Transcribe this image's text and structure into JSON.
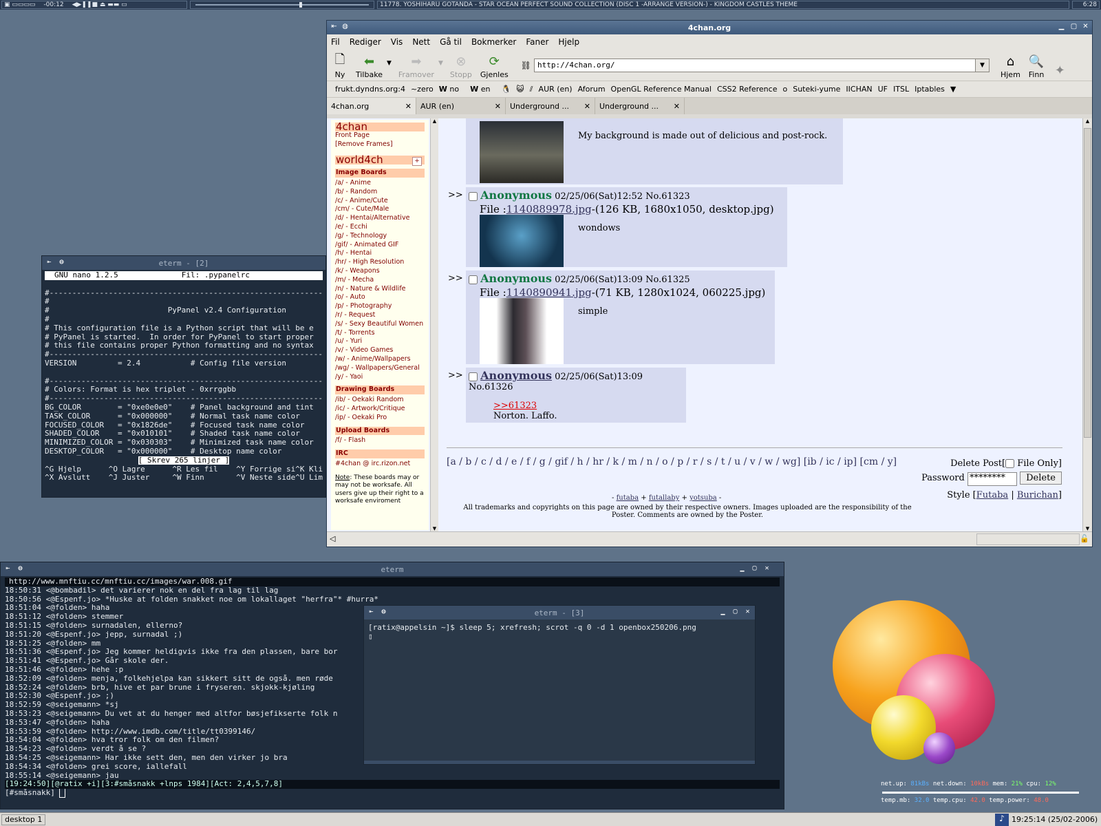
{
  "topbar": {
    "clock_left": "-00:12",
    "now_playing": "11778. YOSHIHARU GOTANDA - STAR OCEAN PERFECT SOUND COLLECTION (DISC 1 -ARRANGE VERSION-) - KINGDOM  CASTLES THEME",
    "time_right": "6:28"
  },
  "browser": {
    "title": "4chan.org",
    "menu": [
      "Fil",
      "Rediger",
      "Vis",
      "Nett",
      "Gå til",
      "Bokmerker",
      "Faner",
      "Hjelp"
    ],
    "toolbar": {
      "new": "Ny",
      "back": "Tilbake",
      "forward": "Framover",
      "stop": "Stopp",
      "reload": "Gjenles",
      "home": "Hjem",
      "find": "Finn"
    },
    "url": "http://4chan.org/",
    "bookmarks": [
      "frukt.dyndns.org:4",
      "~zero",
      "no",
      "en",
      "AUR (en)",
      "Aforum",
      "OpenGL Reference Manual",
      "CSS2 Reference",
      "o",
      "Suteki-yume",
      "IICHAN",
      "UF",
      "ITSL",
      "Iptables"
    ],
    "tabs": [
      "4chan.org",
      "AUR (en)",
      "Underground ...",
      "Underground ..."
    ],
    "sidebar": {
      "brand": "4chan",
      "front": "Front Page",
      "remove": "[Remove Frames]",
      "world": "world4ch",
      "world_btn": "+",
      "image_boards_title": "Image Boards",
      "image_boards": [
        "/a/ - Anime",
        "/b/ - Random",
        "/c/ - Anime/Cute",
        "/cm/ - Cute/Male",
        "/d/ - Hentai/Alternative",
        "/e/ - Ecchi",
        "/g/ - Technology",
        "/gif/ - Animated GIF",
        "/h/ - Hentai",
        "/hr/ - High Resolution",
        "/k/ - Weapons",
        "/m/ - Mecha",
        "/n/ - Nature & Wildlife",
        "/o/ - Auto",
        "/p/ - Photography",
        "/r/ - Request",
        "/s/ - Sexy Beautiful Women",
        "/t/ - Torrents",
        "/u/ - Yuri",
        "/v/ - Video Games",
        "/w/ - Anime/Wallpapers",
        "/wg/ - Wallpapers/General",
        "/y/ - Yaoi"
      ],
      "drawing_title": "Drawing Boards",
      "drawing": [
        "/ib/ - Oekaki Random",
        "/ic/ - Artwork/Critique",
        "/ip/ - Oekaki Pro"
      ],
      "upload_title": "Upload Boards",
      "upload": [
        "/f/ - Flash"
      ],
      "irc_title": "IRC",
      "irc": "#4chan @ irc.rizon.net",
      "note_label": "Note",
      "note": ": These boards may or may not be worksafe. All users give up their right to a worksafe enviroment"
    },
    "posts": [
      {
        "comment": "My background is made out of delicious and post-rock."
      },
      {
        "arrow": ">>",
        "name": "Anonymous",
        "date": "02/25/06(Sat)12:52 No.61323",
        "file_label": "File :",
        "file_link": "1140889978.jpg",
        "file_info": "-(126 KB, 1680x1050, desktop.jpg)",
        "comment": "wondows"
      },
      {
        "arrow": ">>",
        "name": "Anonymous",
        "date": "02/25/06(Sat)13:09 No.61325",
        "file_label": "File :",
        "file_link": "1140890941.jpg",
        "file_info": "-(71 KB, 1280x1024, 060225.jpg)",
        "comment": "simple"
      },
      {
        "arrow": ">>",
        "name": "Anonymous",
        "date": "02/25/06(Sat)13:09 No.61326",
        "quote": ">>61323",
        "comment": "Norton. Laffo."
      }
    ],
    "footer_nav": "[a / b / c / d / e / f / g / gif / h / hr / k / m / n / o / p / r / s / t / u / v / w / wg] [ib / ic / ip] [cm / y]",
    "delete_post": "Delete Post[",
    "file_only": "File Only]",
    "password_label": "Password",
    "password_value": "********",
    "delete_btn": "Delete",
    "style_label": "Style [",
    "style_futaba": "Futaba",
    "style_sep": " | ",
    "style_burichan": "Burichan",
    "style_end": "]",
    "credits": [
      "- ",
      "futaba",
      " + ",
      "futallaby",
      " + ",
      "yotsuba",
      " -"
    ],
    "copyright": "All trademarks and copyrights on this page are owned by their respective owners. Images uploaded are the responsibility of the Poster. Comments are owned by the Poster."
  },
  "eterm2": {
    "title": "eterm - [2]",
    "header_left": "GNU nano 1.2.5",
    "header_right": "Fil: .pypanelrc",
    "lines": [
      "",
      "#----------------------------------------------------------------",
      "#",
      "#                          PyPanel v2.4 Configuration",
      "#",
      "# This configuration file is a Python script that will be e",
      "# PyPanel is started.  In order for PyPanel to start proper",
      "# this file contains proper Python formatting and no syntax",
      "#----------------------------------------------------------------",
      "VERSION         = 2.4           # Config file version",
      "",
      "#----------------------------------------------------------------",
      "# Colors: Format is hex triplet - 0xrrggbb",
      "#----------------------------------------------------------------",
      "BG_COLOR        = \"0xe0e0e0\"    # Panel background and tint",
      "TASK_COLOR      = \"0x000000\"    # Normal task name color",
      "FOCUSED_COLOR   = \"0x1826de\"    # Focused task name color",
      "SHADED_COLOR    = \"0x010101\"    # Shaded task name color",
      "MINIMIZED_COLOR = \"0x030303\"    # Minimized task name color",
      "DESKTOP_COLOR   = \"0x000000\"    # Desktop name color"
    ],
    "status": "[ Skrev 265 linjer ]",
    "shortcuts1": "^G Hjelp      ^O Lagre      ^R Les fil    ^Y Forrige si^K Klip",
    "shortcuts2": "^X Avslutt    ^J Juster     ^W Finn       ^V Neste side^U Lim"
  },
  "eterm_irc": {
    "title": "eterm",
    "url_line": "http://www.mnftiu.cc/mnftiu.cc/images/war.008.gif",
    "lines": [
      "18:50:31 <@bombadil> det varierer nok en del fra lag til lag",
      "18:50:56 <@Espenf.jo> *Huske at folden snakket noe om lokallaget \"herfra\"* #hurra*",
      "18:51:04 <@folden> haha",
      "18:51:12 <@folden> stemmer",
      "18:51:15 <@folden> surnadalen, ellerno?",
      "18:51:20 <@Espenf.jo> jepp, surnadal ;)",
      "18:51:25 <@folden> mm",
      "18:51:36 <@Espenf.jo> Jeg kommer heldigvis ikke fra den plassen, bare bor",
      "18:51:41 <@Espenf.jo> Går skole der.",
      "18:51:46 <@folden> hehe :p",
      "18:52:09 <@folden> menja, folkehjelpa kan sikkert sitt de også. men røde",
      "18:52:24 <@folden> brb, hive et par brune i fryseren. skjokk-kjøling",
      "18:52:30 <@Espenf.jo> ;)",
      "18:52:59 <@seigemann> *sj",
      "18:53:23 <@seigemann> Du vet at du henger med altfor bøsjefikserte folk n",
      "18:53:47 <@folden> haha",
      "18:53:59 <@folden> http://www.imdb.com/title/tt0399146/",
      "18:54:04 <@folden> hva tror folk om den filmen?",
      "18:54:23 <@folden> verdt å se ?",
      "18:54:25 <@seigemann> Har ikke sett den, men den virker jo bra",
      "18:54:34 <@folden> grei score, iallefall",
      "18:55:14 <@seigemann> jau"
    ],
    "statusbar": "[19:24:50][@ratix +i][3:#småsnakk +lnps 1984][Act: 2,4,5,7,8]",
    "prompt": "[#småsnakk] "
  },
  "eterm3": {
    "title": "eterm - [3]",
    "command": "[ratix@appelsin ~]$ sleep 5; xrefresh; scrot -q 0 -d 1 openbox250206.png"
  },
  "sysmon": {
    "line1": [
      "net.up: ",
      "81kBs",
      " net.down: ",
      "10kBs",
      " mem: ",
      "21%",
      " cpu: ",
      "12%"
    ],
    "line2": [
      "temp.mb: ",
      "32.0",
      " temp.cpu: ",
      "42.0",
      " temp.power: ",
      "48.0"
    ]
  },
  "taskbar": {
    "desktop": "desktop 1",
    "clock": "19:25:14 (25/02-2006)"
  }
}
